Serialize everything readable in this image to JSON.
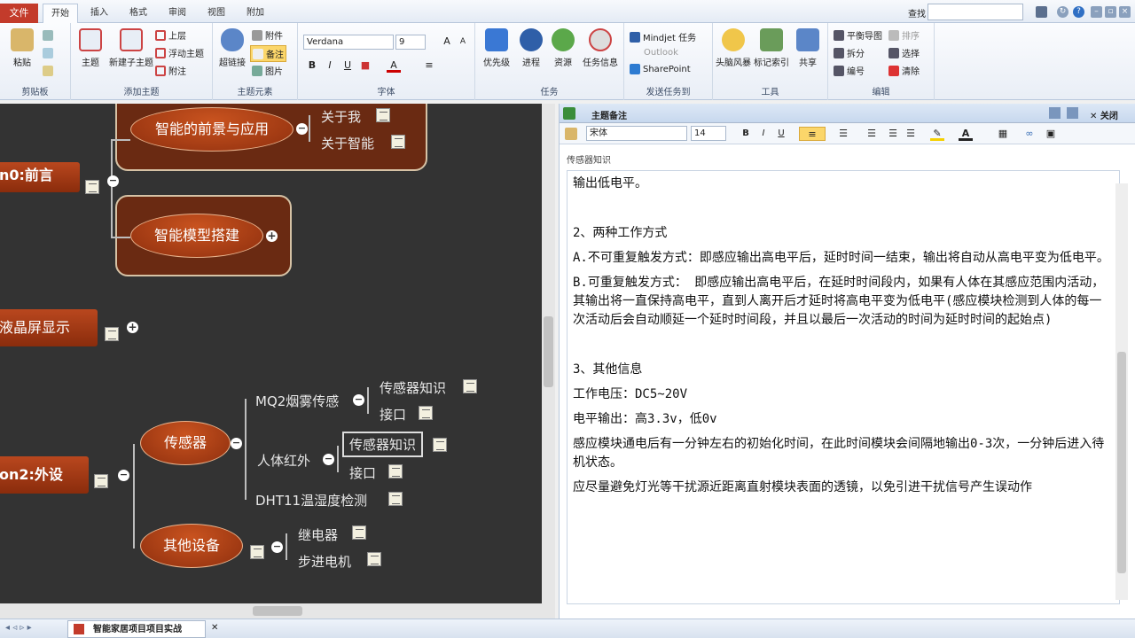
{
  "tabs": {
    "file": "文件",
    "home": "开始",
    "insert": "插入",
    "format": "格式",
    "review": "审阅",
    "view": "视图",
    "addons": "附加"
  },
  "find": {
    "label": "查找"
  },
  "ribbon": {
    "clipboard": {
      "paste": "粘贴",
      "label": "剪贴板"
    },
    "addtopic": {
      "topic": "主题",
      "subtopic": "新建子主题",
      "upper": "上层",
      "floating": "浮动主题",
      "callout": "附注",
      "label": "添加主题"
    },
    "elements": {
      "hyperlink": "超链接",
      "attachment": "附件",
      "notes": "备注",
      "image": "图片",
      "label": "主题元素"
    },
    "font": {
      "name": "Verdana",
      "size": "9",
      "label": "字体"
    },
    "tasks": {
      "priority": "优先级",
      "progress": "进程",
      "resource": "资源",
      "taskinfo": "任务信息",
      "label": "任务"
    },
    "send": {
      "mindjet": "Mindjet 任务",
      "outlook": "Outlook",
      "sharepoint": "SharePoint",
      "label": "发送任务到"
    },
    "tools": {
      "brainstorm": "头脑风暴",
      "index": "标记索引",
      "share": "共享",
      "label": "工具"
    },
    "edit": {
      "balance": "平衡导图",
      "split": "拆分",
      "number": "编号",
      "sort": "排序",
      "select": "选择",
      "clear": "清除",
      "label": "编辑"
    }
  },
  "map": {
    "front": "n0:前言",
    "prospect": "智能的前景与应用",
    "aboutme": "关于我",
    "aboutai": "关于智能",
    "model": "智能模型搭建",
    "lcd": "液晶屏显示",
    "peripheral": "on2:外设",
    "sensor": "传感器",
    "mq2": "MQ2烟雾传感",
    "knowledge1": "传感器知识",
    "port1": "接口",
    "infrared": "人体红外",
    "knowledge2": "传感器知识",
    "port2": "接口",
    "dht11": "DHT11温湿度检测",
    "other": "其他设备",
    "relay": "继电器",
    "stepper": "步进电机"
  },
  "notes": {
    "header": "主题备注",
    "close": "关闭",
    "font": "宋体",
    "size": "14",
    "topic": "传感器知识",
    "lines": [
      "输出低电平。",
      "",
      "2、两种工作方式",
      "A.不可重复触发方式：即感应输出高电平后，延时时间一结束，输出将自动从高电平变为低电平。",
      "B.可重复触发方式： 即感应输出高电平后，在延时时间段内，如果有人体在其感应范围内活动，其输出将一直保持高电平，直到人离开后才延时将高电平变为低电平(感应模块检测到人体的每一次活动后会自动顺延一个延时时间段，并且以最后一次活动的时间为延时时间的起始点)",
      "",
      "3、其他信息",
      "工作电压：DC5~20V",
      "电平输出：高3.3v，低0v",
      "感应模块通电后有一分钟左右的初始化时间，在此时间模块会间隔地输出0-3次，一分钟后进入待机状态。",
      "应尽量避免灯光等干扰源近距离直射模块表面的透镜，以免引进干扰信号产生误动作"
    ]
  },
  "status": {
    "doc": "智能家居项目项目实战"
  }
}
